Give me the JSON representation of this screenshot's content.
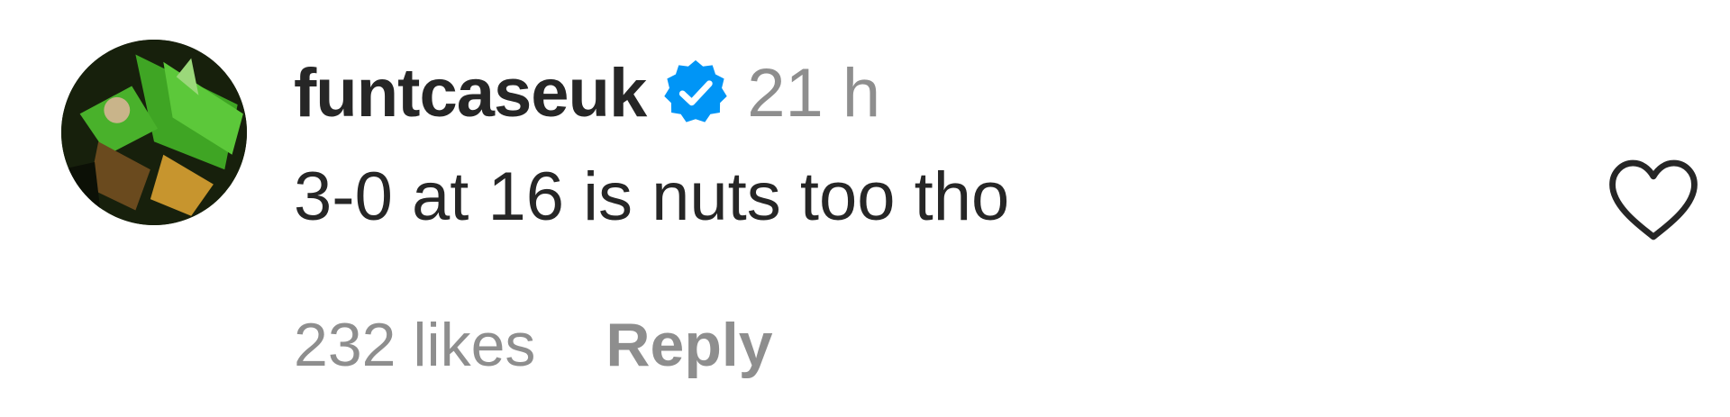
{
  "comment": {
    "username": "funtcaseuk",
    "verified": true,
    "timestamp": "21 h",
    "text": "3-0 at 16 is nuts too tho",
    "likes_label": "232 likes",
    "reply_label": "Reply"
  },
  "icons": {
    "verified": "verified-badge-icon",
    "like": "heart-outline-icon"
  },
  "colors": {
    "text_primary": "#262626",
    "text_secondary": "#8e8e8e",
    "verified_blue": "#0095f6"
  }
}
